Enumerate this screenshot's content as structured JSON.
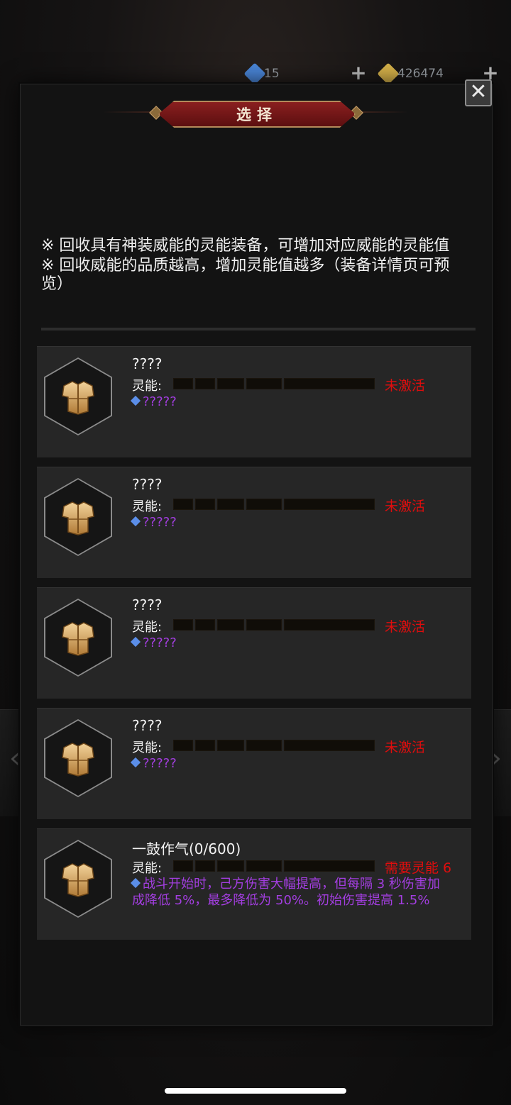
{
  "topbar": {
    "gems": "15",
    "gold": "426474",
    "gem_color": "#4a86d8",
    "gold_color": "#d6b24a"
  },
  "dialog": {
    "title": "选择",
    "close_icon": "✕",
    "notes": [
      "※ 回收具有神装威能的灵能装备，可增加对应威能的灵能值",
      "※ 回收威能的品质越高，增加灵能值越多（装备详情页可预览）"
    ],
    "power_label": "灵能:",
    "items": [
      {
        "name": "????",
        "status": "未激活",
        "effect": "?????",
        "icon": "armor-icon"
      },
      {
        "name": "????",
        "status": "未激活",
        "effect": "?????",
        "icon": "armor-icon"
      },
      {
        "name": "????",
        "status": "未激活",
        "effect": "?????",
        "icon": "armor-icon"
      },
      {
        "name": "????",
        "status": "未激活",
        "effect": "?????",
        "icon": "armor-icon"
      },
      {
        "name": "一鼓作气(0/600)",
        "status": "需要灵能 6",
        "effect": "战斗开始时，己方伤害大幅提高，但每隔 3 秒伤害加成降低 5%，最多降低为 50%。初始伤害提高 1.5%",
        "icon": "armor-icon"
      }
    ]
  },
  "colors": {
    "status_red": "#e00d0d",
    "effect_purple": "#a33ee0",
    "banner_red": "#8a1f1f"
  }
}
